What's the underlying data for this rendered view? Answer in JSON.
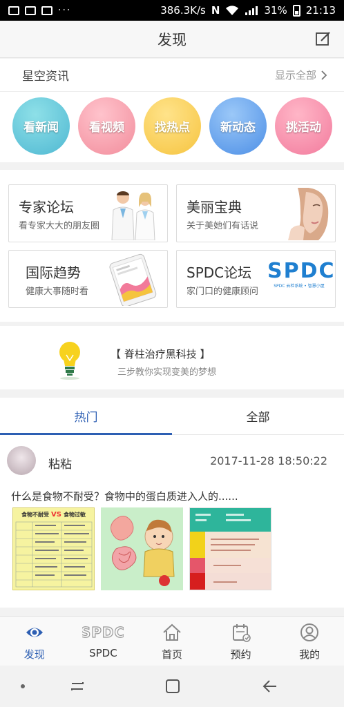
{
  "status_bar": {
    "speed": "386.3K/s",
    "battery": "31%",
    "time": "21:13",
    "dots": "···"
  },
  "header": {
    "title": "发现"
  },
  "news": {
    "label": "星空资讯",
    "show_all": "显示全部",
    "circles": [
      "看新闻",
      "看视频",
      "找热点",
      "新动态",
      "挑活动"
    ]
  },
  "cards": [
    {
      "title": "专家论坛",
      "subtitle": "看专家大大的朋友圈"
    },
    {
      "title": "美丽宝典",
      "subtitle": "关于美她们有话说"
    },
    {
      "title": "国际趋势",
      "subtitle": "健康大事随时看"
    },
    {
      "title": "SPDC论坛",
      "subtitle": "家门口的健康顾问",
      "logo": "SPDC",
      "logo_caption": "SPDC 云检系统 • 智慧小屋"
    }
  ],
  "promo": {
    "title": "【 脊柱治疗黑科技 】",
    "subtitle": "三步教你实现变美的梦想"
  },
  "tabs": [
    {
      "label": "热门",
      "active": true
    },
    {
      "label": "全部",
      "active": false
    }
  ],
  "post": {
    "author": "粘粘",
    "timestamp": "2017-11-28 18:50:22",
    "text": "什么是食物不耐受？食物中的蛋白质进入人的......",
    "image1_title": "食物不耐受",
    "image1_vs": "VS",
    "image1_title2": "食物过敏"
  },
  "bottom_nav": [
    {
      "label": "发现",
      "icon": "eye-icon",
      "active": true
    },
    {
      "label": "SPDC",
      "icon": "spdc-logo-icon",
      "active": false
    },
    {
      "label": "首页",
      "icon": "home-icon",
      "active": false
    },
    {
      "label": "预约",
      "icon": "calendar-icon",
      "active": false
    },
    {
      "label": "我的",
      "icon": "user-icon",
      "active": false
    }
  ],
  "colors": {
    "accent": "#2d5fb3"
  }
}
